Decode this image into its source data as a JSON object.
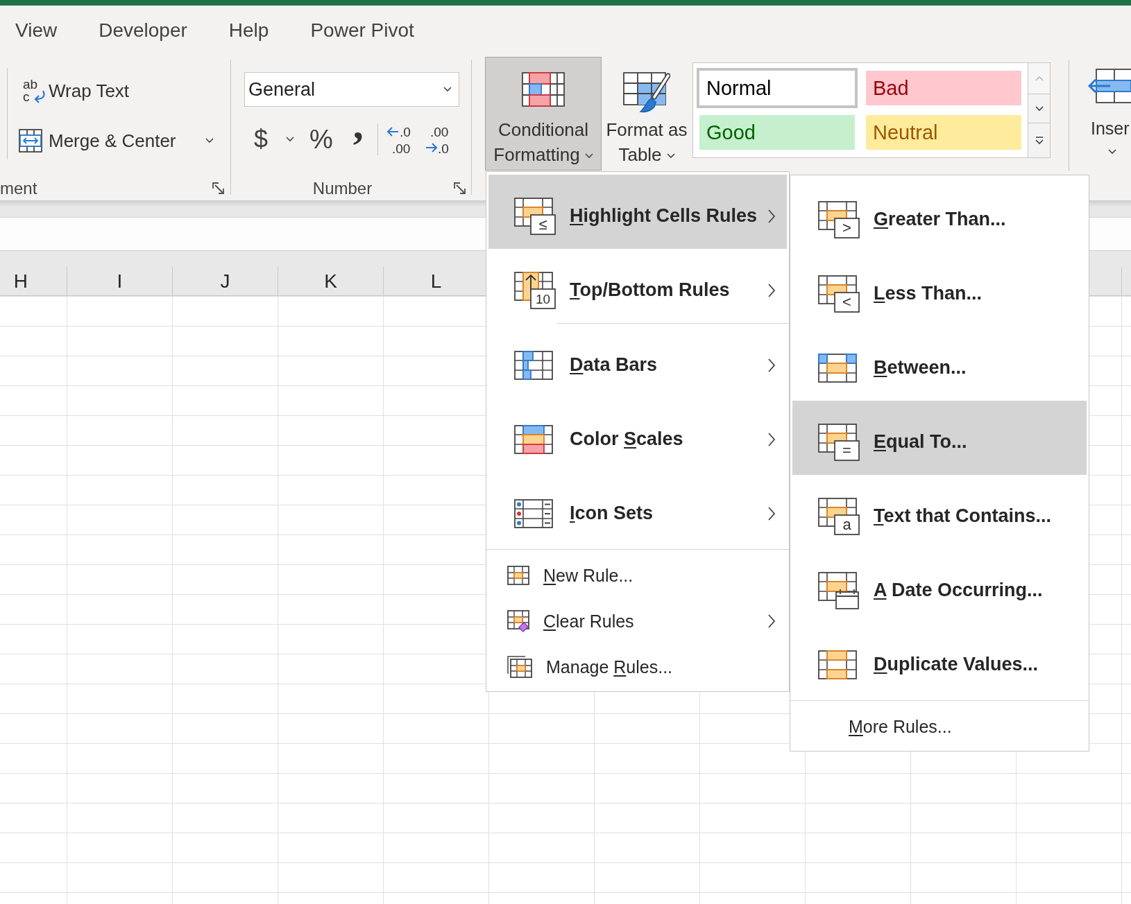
{
  "ribbon": {
    "tabs": [
      {
        "label": "View",
        "selected": false
      },
      {
        "label": "Developer",
        "selected": false
      },
      {
        "label": "Help",
        "selected": false
      },
      {
        "label": "Power Pivot",
        "selected": false
      }
    ],
    "alignment_group": {
      "label": "ment",
      "wrap_text": {
        "label": "Wrap Text",
        "icon_text": [
          "ab",
          "c"
        ]
      },
      "merge_center": {
        "label": "Merge & Center"
      }
    },
    "number_group": {
      "label": "Number",
      "format_box": {
        "value": "General"
      },
      "buttons": [
        {
          "kind": "currency",
          "label": "$"
        },
        {
          "kind": "dropdown"
        },
        {
          "kind": "percent",
          "label": "%"
        },
        {
          "kind": "comma",
          "label": ","
        },
        {
          "kind": "increase_decimal",
          "icon_text": [
            ".0",
            ".00"
          ]
        },
        {
          "kind": "decrease_decimal",
          "icon_text": [
            ".00",
            ".0"
          ]
        }
      ]
    },
    "styles_group": {
      "conditional_formatting": {
        "label": "Conditional Formatting",
        "expanded": true
      },
      "format_as_table": {
        "label": "Format as Table",
        "expanded": false
      },
      "cell_styles": [
        {
          "label": "Normal",
          "kind": "normal",
          "selected": true
        },
        {
          "label": "Bad",
          "kind": "bad",
          "selected": false
        },
        {
          "label": "Good",
          "kind": "good",
          "selected": false
        },
        {
          "label": "Neutral",
          "kind": "neutral",
          "selected": false
        }
      ],
      "gallery_scroll": [
        {
          "kind": "up",
          "disabled": true
        },
        {
          "kind": "down",
          "disabled": false
        },
        {
          "kind": "more",
          "disabled": false
        }
      ]
    },
    "cells_group": {
      "insert": {
        "label": "Inser"
      }
    }
  },
  "sheet": {
    "columns": [
      "H",
      "I",
      "J",
      "K",
      "L"
    ]
  },
  "menu": {
    "sections": [
      {
        "items": [
          {
            "kind": "large",
            "accel": "H",
            "rest": "ighlight Cells Rules",
            "icon_text": "≤",
            "submenu": true,
            "selected": true
          },
          {
            "kind": "large",
            "accel": "T",
            "rest": "op/Bottom Rules",
            "icon_text": "10",
            "submenu": true,
            "selected": false
          }
        ]
      },
      {
        "items": [
          {
            "kind": "large",
            "accel": "D",
            "rest": "ata Bars",
            "submenu": true,
            "selected": false
          },
          {
            "kind": "large",
            "lead": "Color ",
            "accel": "S",
            "rest": "cales",
            "submenu": true,
            "selected": false
          },
          {
            "kind": "large",
            "accel": "I",
            "rest": "con Sets",
            "submenu": true,
            "selected": false
          }
        ]
      },
      {
        "items": [
          {
            "kind": "small",
            "accel": "N",
            "rest": "ew Rule...",
            "submenu": false,
            "selected": false
          },
          {
            "kind": "small",
            "accel": "C",
            "rest": "lear Rules",
            "submenu": true,
            "selected": false
          },
          {
            "kind": "small",
            "lead": "Manage ",
            "accel": "R",
            "rest": "ules...",
            "submenu": false,
            "selected": false
          }
        ]
      }
    ]
  },
  "submenu": {
    "sections": [
      {
        "items": [
          {
            "kind": "large",
            "accel": "G",
            "rest": "reater Than...",
            "icon_text": ">",
            "selected": false
          },
          {
            "kind": "large",
            "accel": "L",
            "rest": "ess Than...",
            "icon_text": "<",
            "selected": false
          },
          {
            "kind": "large",
            "accel": "B",
            "rest": "etween...",
            "selected": false
          },
          {
            "kind": "large",
            "accel": "E",
            "rest": "qual To...",
            "icon_text": "=",
            "selected": true
          },
          {
            "kind": "large",
            "accel": "T",
            "rest": "ext that Contains...",
            "icon_text": "a",
            "selected": false
          },
          {
            "kind": "large",
            "accel": "A",
            "rest": " Date Occurring...",
            "selected": false
          },
          {
            "kind": "large",
            "accel": "D",
            "rest": "uplicate Values...",
            "selected": false
          }
        ]
      },
      {
        "items": [
          {
            "kind": "small",
            "accel": "M",
            "rest": "ore Rules...",
            "selected": false
          }
        ]
      }
    ]
  }
}
